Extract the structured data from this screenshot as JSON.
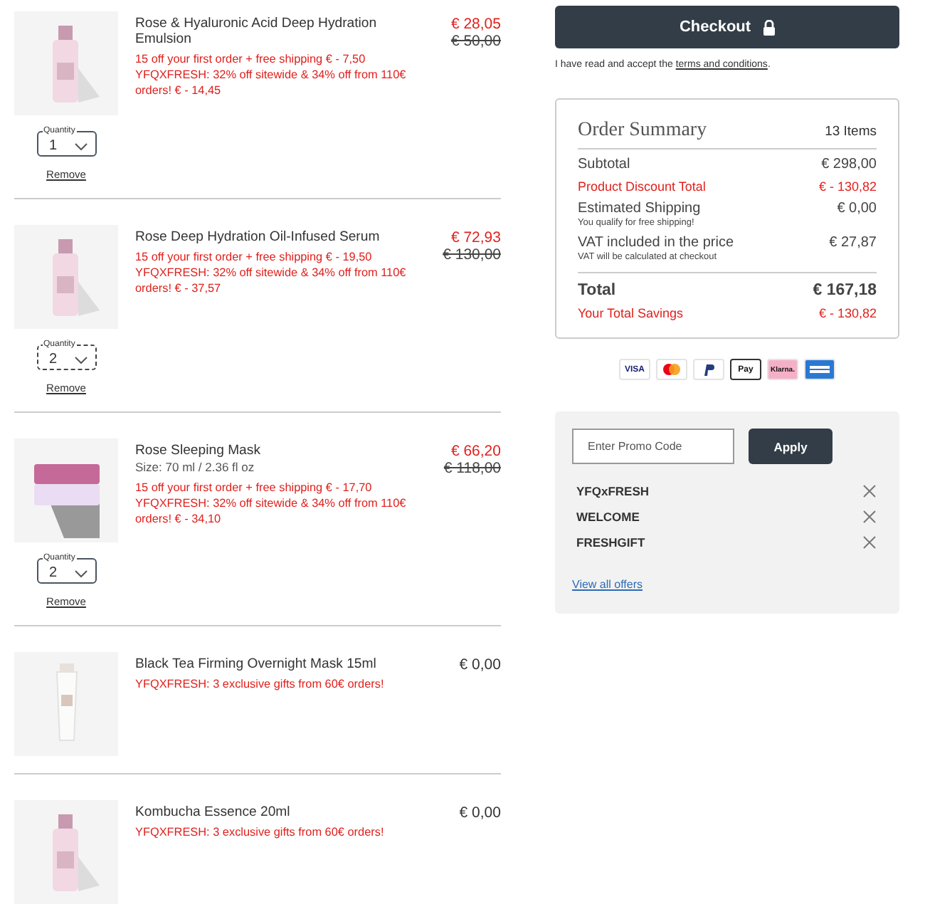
{
  "cart_items": [
    {
      "kind": "bottle",
      "name": "Rose & Hyaluronic Acid Deep Hydration Emulsion",
      "offers": [
        "15 off your first order + free shipping € - 7,50",
        "YFQXFRESH: 32% off sitewide & 34% off from 110€ orders! € - 14,45"
      ],
      "price": "€ 28,05",
      "old_price": "€ 50,00",
      "quantity": {
        "label": "Quantity",
        "value": "1",
        "focused": false
      },
      "remove": "Remove"
    },
    {
      "kind": "bottle",
      "name": "Rose Deep Hydration Oil-Infused Serum",
      "offers": [
        "15 off your first order + free shipping € - 19,50",
        "YFQXFRESH: 32% off sitewide & 34% off from 110€ orders! € - 37,57"
      ],
      "price": "€ 72,93",
      "old_price": "€ 130,00",
      "quantity": {
        "label": "Quantity",
        "value": "2",
        "focused": true
      },
      "remove": "Remove"
    },
    {
      "kind": "jar",
      "name": "Rose Sleeping Mask",
      "size": "Size: 70 ml / 2.36 fl oz",
      "offers": [
        "15 off your first order + free shipping € - 17,70",
        "YFQXFRESH: 32% off sitewide & 34% off from 110€ orders! € - 34,10"
      ],
      "price": "€ 66,20",
      "old_price": "€ 118,00",
      "quantity": {
        "label": "Quantity",
        "value": "2",
        "focused": false
      },
      "remove": "Remove"
    },
    {
      "kind": "tube",
      "name": "Black Tea Firming Overnight Mask 15ml",
      "offers": [
        "YFQXFRESH: 3 exclusive gifts from 60€ orders!"
      ],
      "price": "€ 0,00"
    },
    {
      "kind": "bottle",
      "name": "Kombucha Essence 20ml",
      "offers": [
        "YFQXFRESH: 3 exclusive gifts from 60€ orders!"
      ],
      "price": "€ 0,00"
    }
  ],
  "checkout": {
    "button": "Checkout",
    "terms_prefix": "I have read and accept the ",
    "terms_link": "terms and conditions",
    "terms_suffix": "."
  },
  "order_summary": {
    "title": "Order Summary",
    "count": "13 Items",
    "rows": [
      {
        "kind": "normal",
        "label": "Subtotal",
        "value": "€ 298,00"
      },
      {
        "kind": "discount",
        "label": "Product Discount Total",
        "value": "€ - 130,82"
      },
      {
        "kind": "normal",
        "label": "Estimated Shipping",
        "value": "€ 0,00",
        "note": "You qualify for free shipping!"
      },
      {
        "kind": "normal",
        "label": "VAT included in the price",
        "value": "€ 27,87",
        "note": "VAT will be calculated at checkout"
      },
      {
        "kind": "total",
        "label": "Total",
        "value": "€ 167,18"
      },
      {
        "kind": "discount",
        "label": "Your Total Savings",
        "value": "€ - 130,82"
      }
    ]
  },
  "payment_methods": [
    {
      "kind": "visa",
      "label": "VISA"
    },
    {
      "kind": "mastercard"
    },
    {
      "kind": "paypal"
    },
    {
      "kind": "applepay",
      "label": "Pay"
    },
    {
      "kind": "klarna",
      "label": "Klarna."
    },
    {
      "kind": "amex"
    }
  ],
  "promo": {
    "placeholder": "Enter Promo Code",
    "button": "Apply",
    "codes": [
      "YFQxFRESH",
      "WELCOME",
      "FRESHGIFT"
    ],
    "link": "View all offers"
  }
}
